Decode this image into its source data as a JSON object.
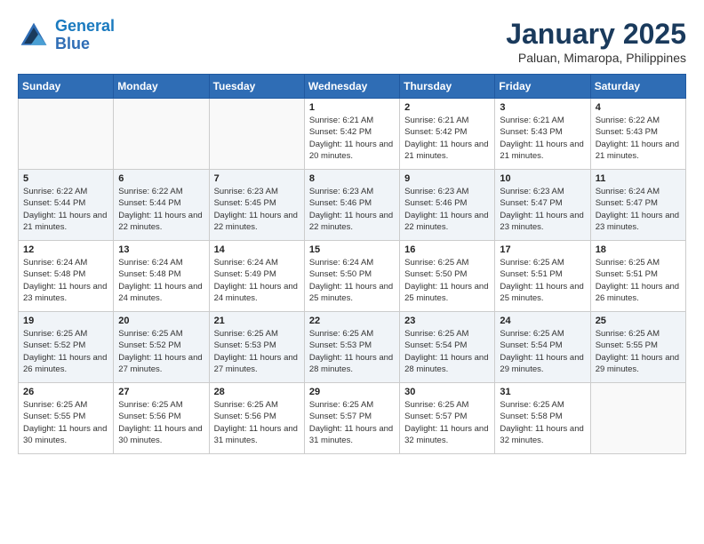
{
  "header": {
    "logo_line1": "General",
    "logo_line2": "Blue",
    "month": "January 2025",
    "location": "Paluan, Mimaropa, Philippines"
  },
  "weekdays": [
    "Sunday",
    "Monday",
    "Tuesday",
    "Wednesday",
    "Thursday",
    "Friday",
    "Saturday"
  ],
  "weeks": [
    [
      {
        "day": "",
        "sunrise": "",
        "sunset": "",
        "daylight": ""
      },
      {
        "day": "",
        "sunrise": "",
        "sunset": "",
        "daylight": ""
      },
      {
        "day": "",
        "sunrise": "",
        "sunset": "",
        "daylight": ""
      },
      {
        "day": "1",
        "sunrise": "Sunrise: 6:21 AM",
        "sunset": "Sunset: 5:42 PM",
        "daylight": "Daylight: 11 hours and 20 minutes."
      },
      {
        "day": "2",
        "sunrise": "Sunrise: 6:21 AM",
        "sunset": "Sunset: 5:42 PM",
        "daylight": "Daylight: 11 hours and 21 minutes."
      },
      {
        "day": "3",
        "sunrise": "Sunrise: 6:21 AM",
        "sunset": "Sunset: 5:43 PM",
        "daylight": "Daylight: 11 hours and 21 minutes."
      },
      {
        "day": "4",
        "sunrise": "Sunrise: 6:22 AM",
        "sunset": "Sunset: 5:43 PM",
        "daylight": "Daylight: 11 hours and 21 minutes."
      }
    ],
    [
      {
        "day": "5",
        "sunrise": "Sunrise: 6:22 AM",
        "sunset": "Sunset: 5:44 PM",
        "daylight": "Daylight: 11 hours and 21 minutes."
      },
      {
        "day": "6",
        "sunrise": "Sunrise: 6:22 AM",
        "sunset": "Sunset: 5:44 PM",
        "daylight": "Daylight: 11 hours and 22 minutes."
      },
      {
        "day": "7",
        "sunrise": "Sunrise: 6:23 AM",
        "sunset": "Sunset: 5:45 PM",
        "daylight": "Daylight: 11 hours and 22 minutes."
      },
      {
        "day": "8",
        "sunrise": "Sunrise: 6:23 AM",
        "sunset": "Sunset: 5:46 PM",
        "daylight": "Daylight: 11 hours and 22 minutes."
      },
      {
        "day": "9",
        "sunrise": "Sunrise: 6:23 AM",
        "sunset": "Sunset: 5:46 PM",
        "daylight": "Daylight: 11 hours and 22 minutes."
      },
      {
        "day": "10",
        "sunrise": "Sunrise: 6:23 AM",
        "sunset": "Sunset: 5:47 PM",
        "daylight": "Daylight: 11 hours and 23 minutes."
      },
      {
        "day": "11",
        "sunrise": "Sunrise: 6:24 AM",
        "sunset": "Sunset: 5:47 PM",
        "daylight": "Daylight: 11 hours and 23 minutes."
      }
    ],
    [
      {
        "day": "12",
        "sunrise": "Sunrise: 6:24 AM",
        "sunset": "Sunset: 5:48 PM",
        "daylight": "Daylight: 11 hours and 23 minutes."
      },
      {
        "day": "13",
        "sunrise": "Sunrise: 6:24 AM",
        "sunset": "Sunset: 5:48 PM",
        "daylight": "Daylight: 11 hours and 24 minutes."
      },
      {
        "day": "14",
        "sunrise": "Sunrise: 6:24 AM",
        "sunset": "Sunset: 5:49 PM",
        "daylight": "Daylight: 11 hours and 24 minutes."
      },
      {
        "day": "15",
        "sunrise": "Sunrise: 6:24 AM",
        "sunset": "Sunset: 5:50 PM",
        "daylight": "Daylight: 11 hours and 25 minutes."
      },
      {
        "day": "16",
        "sunrise": "Sunrise: 6:25 AM",
        "sunset": "Sunset: 5:50 PM",
        "daylight": "Daylight: 11 hours and 25 minutes."
      },
      {
        "day": "17",
        "sunrise": "Sunrise: 6:25 AM",
        "sunset": "Sunset: 5:51 PM",
        "daylight": "Daylight: 11 hours and 25 minutes."
      },
      {
        "day": "18",
        "sunrise": "Sunrise: 6:25 AM",
        "sunset": "Sunset: 5:51 PM",
        "daylight": "Daylight: 11 hours and 26 minutes."
      }
    ],
    [
      {
        "day": "19",
        "sunrise": "Sunrise: 6:25 AM",
        "sunset": "Sunset: 5:52 PM",
        "daylight": "Daylight: 11 hours and 26 minutes."
      },
      {
        "day": "20",
        "sunrise": "Sunrise: 6:25 AM",
        "sunset": "Sunset: 5:52 PM",
        "daylight": "Daylight: 11 hours and 27 minutes."
      },
      {
        "day": "21",
        "sunrise": "Sunrise: 6:25 AM",
        "sunset": "Sunset: 5:53 PM",
        "daylight": "Daylight: 11 hours and 27 minutes."
      },
      {
        "day": "22",
        "sunrise": "Sunrise: 6:25 AM",
        "sunset": "Sunset: 5:53 PM",
        "daylight": "Daylight: 11 hours and 28 minutes."
      },
      {
        "day": "23",
        "sunrise": "Sunrise: 6:25 AM",
        "sunset": "Sunset: 5:54 PM",
        "daylight": "Daylight: 11 hours and 28 minutes."
      },
      {
        "day": "24",
        "sunrise": "Sunrise: 6:25 AM",
        "sunset": "Sunset: 5:54 PM",
        "daylight": "Daylight: 11 hours and 29 minutes."
      },
      {
        "day": "25",
        "sunrise": "Sunrise: 6:25 AM",
        "sunset": "Sunset: 5:55 PM",
        "daylight": "Daylight: 11 hours and 29 minutes."
      }
    ],
    [
      {
        "day": "26",
        "sunrise": "Sunrise: 6:25 AM",
        "sunset": "Sunset: 5:55 PM",
        "daylight": "Daylight: 11 hours and 30 minutes."
      },
      {
        "day": "27",
        "sunrise": "Sunrise: 6:25 AM",
        "sunset": "Sunset: 5:56 PM",
        "daylight": "Daylight: 11 hours and 30 minutes."
      },
      {
        "day": "28",
        "sunrise": "Sunrise: 6:25 AM",
        "sunset": "Sunset: 5:56 PM",
        "daylight": "Daylight: 11 hours and 31 minutes."
      },
      {
        "day": "29",
        "sunrise": "Sunrise: 6:25 AM",
        "sunset": "Sunset: 5:57 PM",
        "daylight": "Daylight: 11 hours and 31 minutes."
      },
      {
        "day": "30",
        "sunrise": "Sunrise: 6:25 AM",
        "sunset": "Sunset: 5:57 PM",
        "daylight": "Daylight: 11 hours and 32 minutes."
      },
      {
        "day": "31",
        "sunrise": "Sunrise: 6:25 AM",
        "sunset": "Sunset: 5:58 PM",
        "daylight": "Daylight: 11 hours and 32 minutes."
      },
      {
        "day": "",
        "sunrise": "",
        "sunset": "",
        "daylight": ""
      }
    ]
  ]
}
